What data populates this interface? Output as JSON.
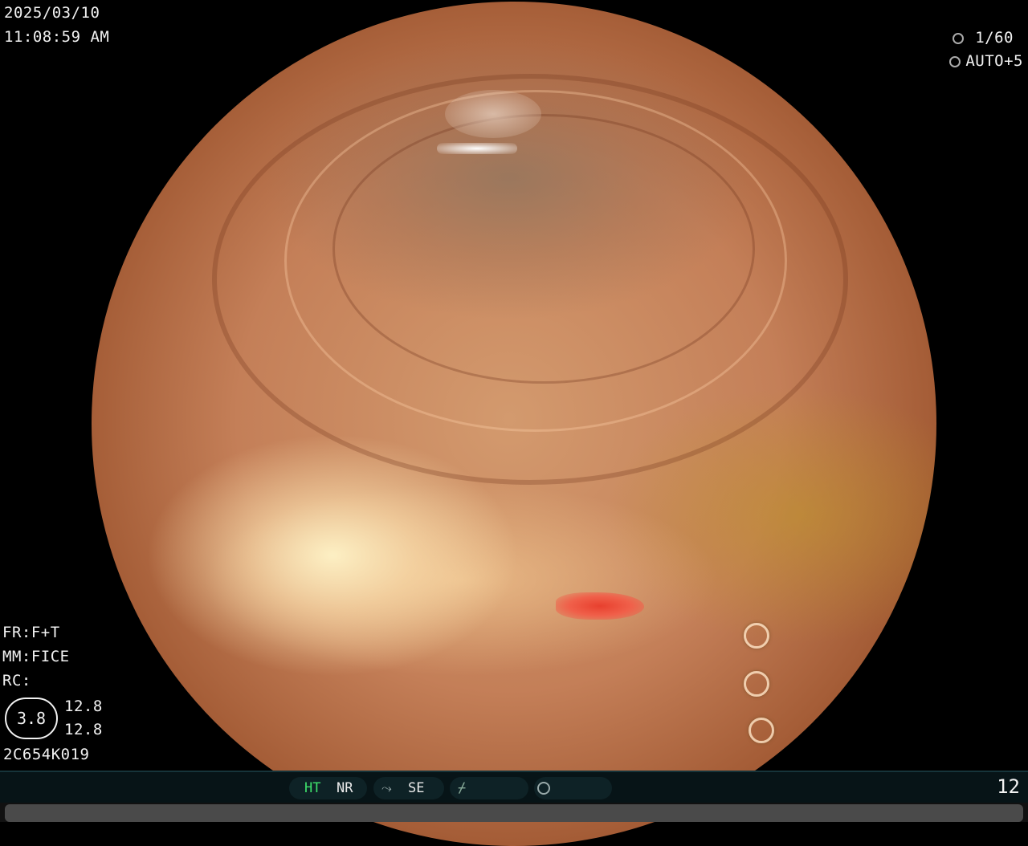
{
  "header": {
    "date": "2025/03/10",
    "time": "11:08:59  AM",
    "shutter": "1/60",
    "iris": "AUTO+5",
    "shutter_icon": "shutter-icon",
    "iris_icon": "iris-icon"
  },
  "left_panel": {
    "fr": "FR:F+T",
    "mm": "MM:FICE",
    "rc": "RC:",
    "circle_value": "3.8",
    "value_1": "12.8",
    "value_2": "12.8",
    "serial": "2C654K019"
  },
  "status_bar": {
    "ht": "HT",
    "nr": "NR",
    "se": "SE",
    "page_number": "12",
    "ht_color": "#3ee06b"
  }
}
